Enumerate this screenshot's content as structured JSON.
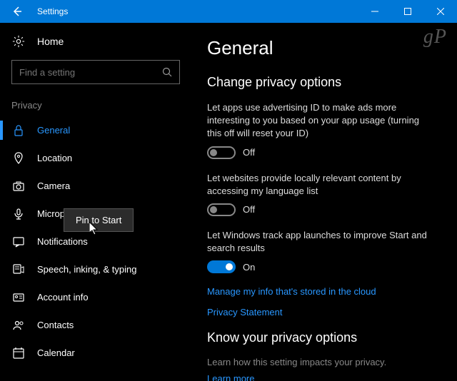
{
  "titlebar": {
    "title": "Settings"
  },
  "watermark": "gP",
  "sidebar": {
    "home": "Home",
    "search_placeholder": "Find a setting",
    "category": "Privacy",
    "items": [
      {
        "label": "General"
      },
      {
        "label": "Location"
      },
      {
        "label": "Camera"
      },
      {
        "label": "Microph"
      },
      {
        "label": "Notifications"
      },
      {
        "label": "Speech, inking, & typing"
      },
      {
        "label": "Account info"
      },
      {
        "label": "Contacts"
      },
      {
        "label": "Calendar"
      }
    ]
  },
  "context_menu": {
    "item": "Pin to Start"
  },
  "content": {
    "title": "General",
    "subtitle": "Change privacy options",
    "opt1": {
      "desc": "Let apps use advertising ID to make ads more interesting to you based on your app usage (turning this off will reset your ID)",
      "state": "Off"
    },
    "opt2": {
      "desc": "Let websites provide locally relevant content by accessing my language list",
      "state": "Off"
    },
    "opt3": {
      "desc": "Let Windows track app launches to improve Start and search results",
      "state": "On"
    },
    "link1": "Manage my info that's stored in the cloud",
    "link2": "Privacy Statement",
    "know_title": "Know your privacy options",
    "know_sub": "Learn how this setting impacts your privacy.",
    "know_link": "Learn more"
  }
}
